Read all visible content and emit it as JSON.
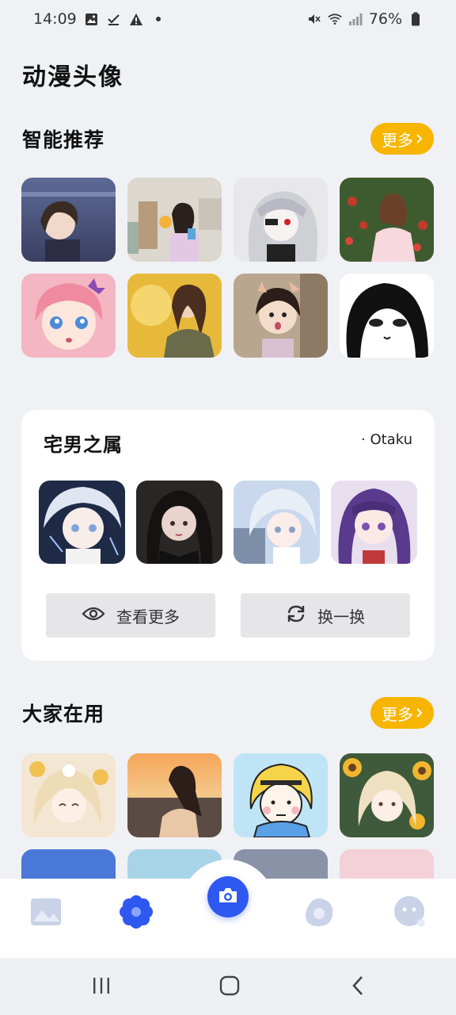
{
  "status": {
    "time": "14:09",
    "battery": "76%"
  },
  "page": {
    "title": "动漫头像"
  },
  "section_recommend": {
    "title": "智能推荐",
    "more_label": "更多",
    "thumbs": [
      {
        "name": "thumb-anime-girl-dusk"
      },
      {
        "name": "thumb-girl-kitchen"
      },
      {
        "name": "thumb-manga-eyepatch"
      },
      {
        "name": "thumb-girl-flowers"
      },
      {
        "name": "thumb-pink-hair-anime"
      },
      {
        "name": "thumb-painted-woman"
      },
      {
        "name": "thumb-little-girl"
      },
      {
        "name": "thumb-manga-girl"
      }
    ]
  },
  "card_otaku": {
    "title": "宅男之属",
    "subtitle": "· Otaku",
    "view_more_label": "查看更多",
    "refresh_label": "换一换"
  },
  "section_popular": {
    "title": "大家在用",
    "more_label": "更多"
  },
  "colors": {
    "accent_yellow": "#f7b500",
    "accent_blue": "#2e58f0",
    "background": "#f0f1f5"
  },
  "tabs": [
    {
      "icon": "gallery-icon",
      "active": false
    },
    {
      "icon": "flower-icon",
      "active": true
    },
    {
      "icon": "camera-icon",
      "active": false
    },
    {
      "icon": "egg-icon",
      "active": false
    },
    {
      "icon": "face-icon",
      "active": false
    }
  ]
}
